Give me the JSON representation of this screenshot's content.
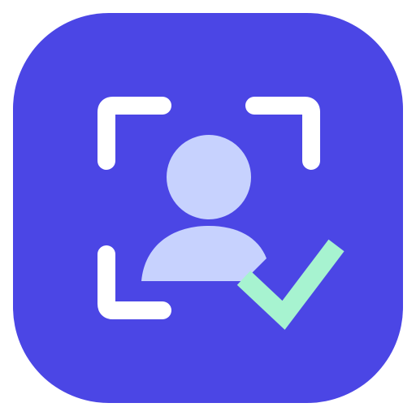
{
  "icon": {
    "kind": "face-verification-app-icon",
    "background_color": "#4B46E5",
    "frame_color": "#FFFFFF",
    "person_color": "#C7D2FE",
    "check_color": "#A7F3D0",
    "parts": [
      "scan-frame-icon",
      "user-silhouette-icon",
      "checkmark-icon"
    ]
  }
}
